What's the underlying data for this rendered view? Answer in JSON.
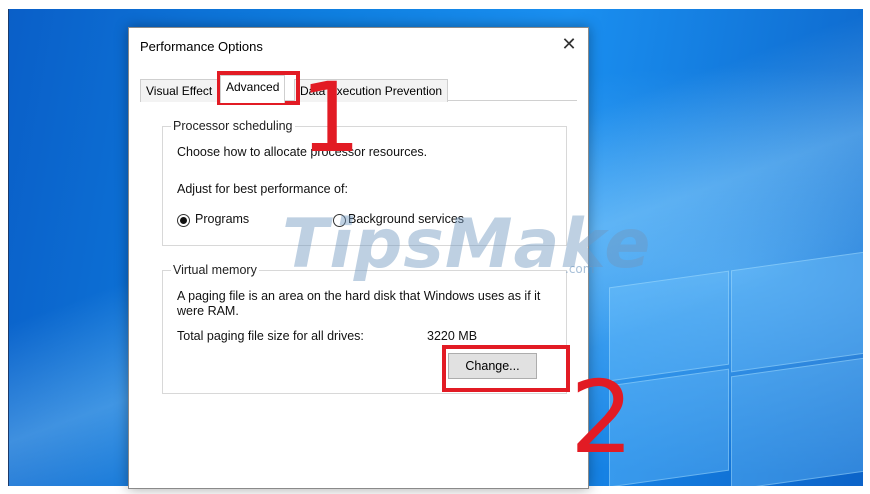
{
  "dialog": {
    "title": "Performance Options",
    "close_glyph": "✕",
    "tabs": [
      {
        "label": "Visual Effect",
        "active": false
      },
      {
        "label": "Advanced",
        "active": true
      },
      {
        "label": "Data Execution Prevention",
        "active": false
      }
    ],
    "processor": {
      "group_label": "Processor scheduling",
      "description": "Choose how to allocate processor resources.",
      "adjust_label": "Adjust for best performance of:",
      "options": [
        {
          "label": "Programs",
          "checked": true
        },
        {
          "label": "Background services",
          "checked": false
        }
      ]
    },
    "virtual_memory": {
      "group_label": "Virtual memory",
      "description_line1": "A paging file is an area on the hard disk that Windows uses as if it",
      "description_line2": "were RAM.",
      "total_label": "Total paging file size for all drives:",
      "total_value": "3220 MB",
      "change_button": "Change..."
    }
  },
  "annotations": {
    "step1": "1",
    "step2": "2",
    "highlight_color": "#e21b24"
  },
  "watermark": {
    "text": "TipsMake",
    "suffix": ".com"
  },
  "icons": {
    "close": "close-icon"
  }
}
